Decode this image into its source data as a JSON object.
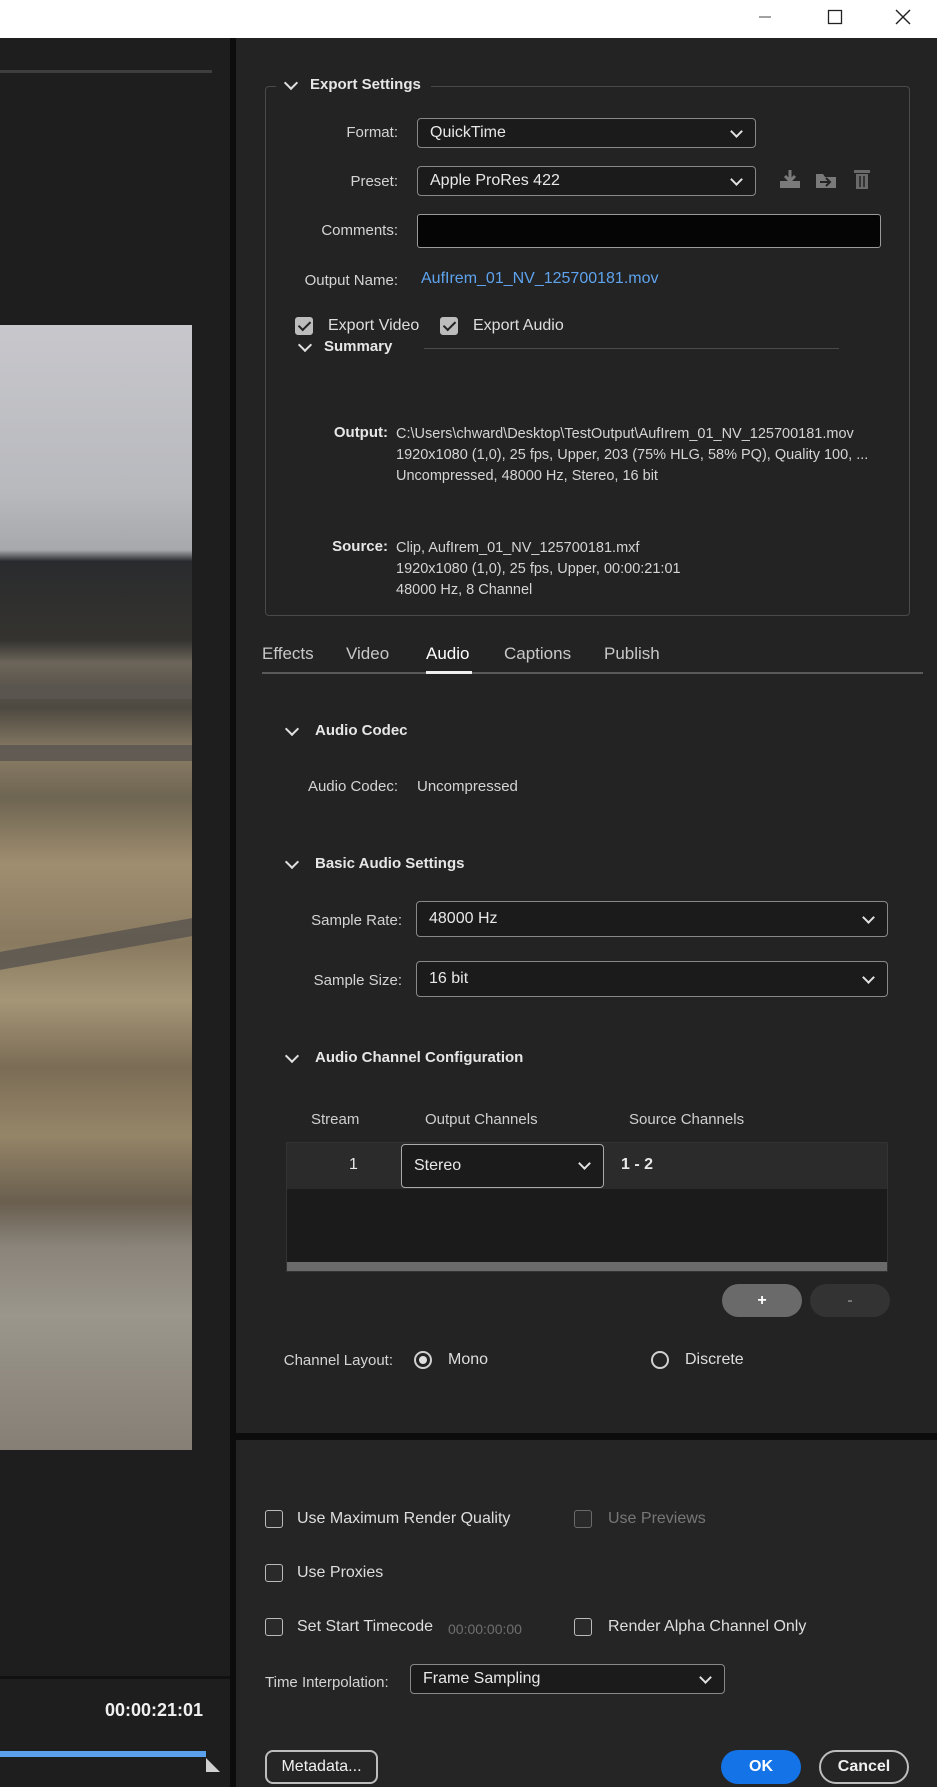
{
  "window": {
    "minimize_icon": "minimize-icon",
    "maximize_icon": "maximize-icon",
    "close_icon": "close-icon"
  },
  "preview": {
    "timecode": "00:00:21:01"
  },
  "export_settings": {
    "title": "Export Settings",
    "format_label": "Format:",
    "format_value": "QuickTime",
    "preset_label": "Preset:",
    "preset_value": "Apple ProRes 422",
    "comments_label": "Comments:",
    "comments_value": "",
    "output_name_label": "Output Name:",
    "output_name_value": "AufIrem_01_NV_125700181.mov",
    "export_video_label": "Export Video",
    "export_video_checked": true,
    "export_audio_label": "Export Audio",
    "export_audio_checked": true,
    "preset_icons": [
      "save-preset-icon",
      "import-preset-icon",
      "delete-preset-icon"
    ]
  },
  "summary": {
    "title": "Summary",
    "output_key": "Output:",
    "output_lines": [
      "C:\\Users\\chward\\Desktop\\TestOutput\\AufIrem_01_NV_125700181.mov",
      "1920x1080 (1,0), 25 fps, Upper, 203 (75% HLG, 58% PQ), Quality 100, ...",
      "Uncompressed, 48000 Hz, Stereo, 16 bit"
    ],
    "source_key": "Source:",
    "source_lines": [
      "Clip, AufIrem_01_NV_125700181.mxf",
      "1920x1080 (1,0), 25 fps, Upper, 00:00:21:01",
      "48000 Hz, 8 Channel"
    ]
  },
  "tabs": [
    "Effects",
    "Video",
    "Audio",
    "Captions",
    "Publish"
  ],
  "active_tab": "Audio",
  "audio": {
    "codec_section": "Audio Codec",
    "codec_label": "Audio Codec:",
    "codec_value": "Uncompressed",
    "basic_section": "Basic Audio Settings",
    "sample_rate_label": "Sample Rate:",
    "sample_rate_value": "48000 Hz",
    "sample_size_label": "Sample Size:",
    "sample_size_value": "16 bit",
    "channel_section": "Audio Channel Configuration",
    "col_stream": "Stream",
    "col_output": "Output Channels",
    "col_source": "Source Channels",
    "streams": [
      {
        "stream": "1",
        "output": "Stereo",
        "source": "1 - 2"
      }
    ],
    "add_label": "+",
    "remove_label": "-",
    "channel_layout_label": "Channel Layout:",
    "layout_mono": "Mono",
    "layout_discrete": "Discrete",
    "layout_selected": "Mono"
  },
  "bottom": {
    "max_render_label": "Use Maximum Render Quality",
    "use_previews_label": "Use Previews",
    "use_proxies_label": "Use Proxies",
    "set_start_tc_label": "Set Start Timecode",
    "start_tc_value": "00:00:00:00",
    "render_alpha_label": "Render Alpha Channel Only",
    "time_interp_label": "Time Interpolation:",
    "time_interp_value": "Frame Sampling",
    "metadata_label": "Metadata...",
    "ok_label": "OK",
    "cancel_label": "Cancel"
  },
  "colors": {
    "accent": "#1473e6",
    "link": "#5ea3ee",
    "panel": "#232323"
  }
}
